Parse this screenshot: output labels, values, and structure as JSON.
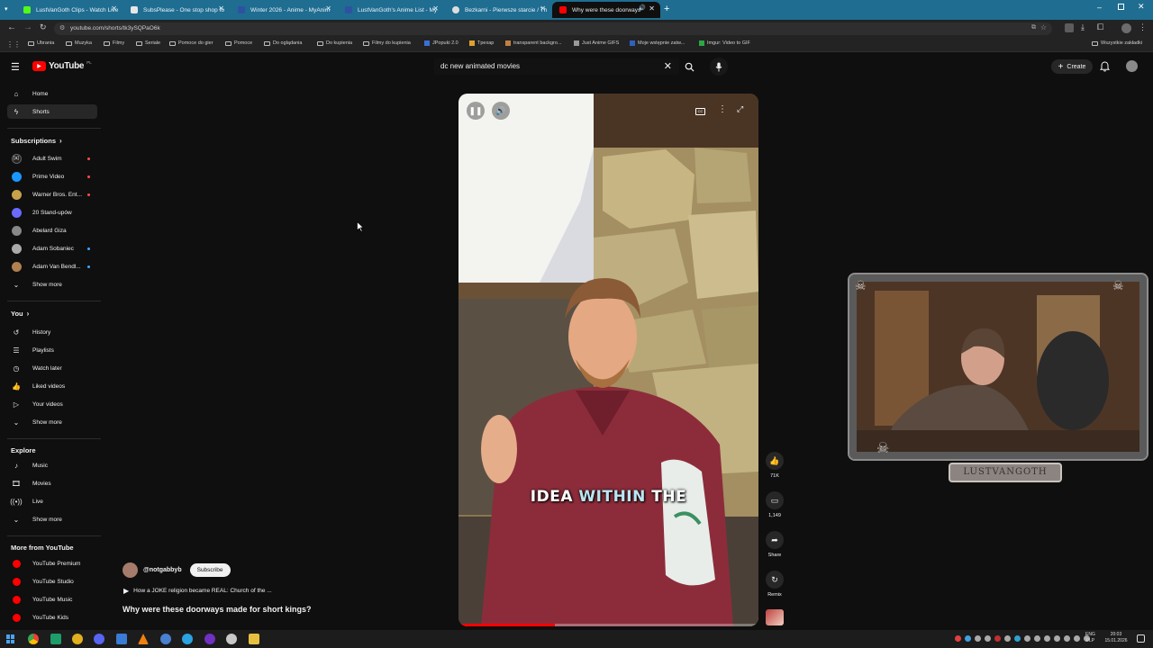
{
  "browser": {
    "tabs": [
      {
        "title": "LustVanGoth Clips - Watch Live",
        "color": "#53fc18"
      },
      {
        "title": "SubsPlease - One stop shop fo",
        "color": "#ffffff"
      },
      {
        "title": "Winter 2026 - Anime - MyAnim",
        "color": "#2e51a2"
      },
      {
        "title": "LustVanGoth's Anime List - My",
        "color": "#2e51a2"
      },
      {
        "title": "Bezkarni - Pierwsze starcie / Th",
        "color": "#dddddd"
      },
      {
        "title": "Why were these doorways",
        "color": "#ff0000"
      }
    ],
    "url": "youtube.com/shorts/tk3ySQPaO6k",
    "bookmarks": [
      "Ubrania",
      "Muzyka",
      "Filmy",
      "Seriale",
      "Pomoce do gier",
      "Pomoce",
      "Do oglądania",
      "Do kupienia",
      "Filmy do kupienia",
      "JPopuki 2.0",
      "Tpexap",
      "transparent backgro...",
      "Just Anime GIFS",
      "Moje wstępnie zatw...",
      "Imgur: Video to GIF"
    ],
    "all_bookmarks_label": "Wszystkie zakładki"
  },
  "header": {
    "logo_text": "YouTube",
    "logo_region": "PL",
    "search_value": "dc new animated movies",
    "create_label": "Create"
  },
  "sidebar": {
    "top": [
      {
        "label": "Home",
        "icon": "home-icon"
      },
      {
        "label": "Shorts",
        "icon": "shorts-icon"
      }
    ],
    "subscriptions_title": "Subscriptions",
    "subscriptions": [
      {
        "label": "Adult Swim",
        "color": "#222222",
        "live": true
      },
      {
        "label": "Prime Video",
        "color": "#1a98ff",
        "live": true
      },
      {
        "label": "Warner Bros. Ent...",
        "color": "#c8a24a",
        "live": true
      },
      {
        "label": "20 Stand-upów",
        "color": "#6a6aff",
        "live": false
      },
      {
        "label": "Abelard Giza",
        "color": "#888888",
        "live": false
      },
      {
        "label": "Adam Sobaniec",
        "color": "#aaaaaa",
        "live": false
      },
      {
        "label": "Adam Van Bendl...",
        "color": "#b08050",
        "live": false
      }
    ],
    "subs_show_more": "Show more",
    "you_title": "You",
    "you_items": [
      {
        "label": "History",
        "icon": "history-icon"
      },
      {
        "label": "Playlists",
        "icon": "playlists-icon"
      },
      {
        "label": "Watch later",
        "icon": "watch-later-icon"
      },
      {
        "label": "Liked videos",
        "icon": "liked-videos-icon"
      },
      {
        "label": "Your videos",
        "icon": "your-videos-icon"
      }
    ],
    "you_show_more": "Show more",
    "explore_title": "Explore",
    "explore_items": [
      {
        "label": "Music",
        "icon": "music-icon"
      },
      {
        "label": "Movies",
        "icon": "movies-icon"
      },
      {
        "label": "Live",
        "icon": "live-icon"
      }
    ],
    "explore_show_more": "Show more",
    "more_title": "More from YouTube",
    "more_items": [
      {
        "label": "YouTube Premium"
      },
      {
        "label": "YouTube Studio"
      },
      {
        "label": "YouTube Music"
      },
      {
        "label": "YouTube Kids"
      }
    ]
  },
  "short": {
    "channel": "@notgabbyb",
    "subscribe_label": "Subscribe",
    "related_title": "How a JOKE religion became REAL: Church of the ...",
    "title": "Why were these doorways made for short kings?",
    "caption_white": "IDEA",
    "caption_highlight": "WITHIN",
    "caption_end": "THE",
    "likes": "71K",
    "comments": "1,149",
    "share_label": "Share",
    "remix_label": "Remix"
  },
  "overlay": {
    "streamer_name": "LUSTVANGOTH"
  },
  "taskbar": {
    "lang_top": "ENG",
    "lang_bottom": "PLP",
    "time": "20:03",
    "date": "15.01.2026"
  }
}
